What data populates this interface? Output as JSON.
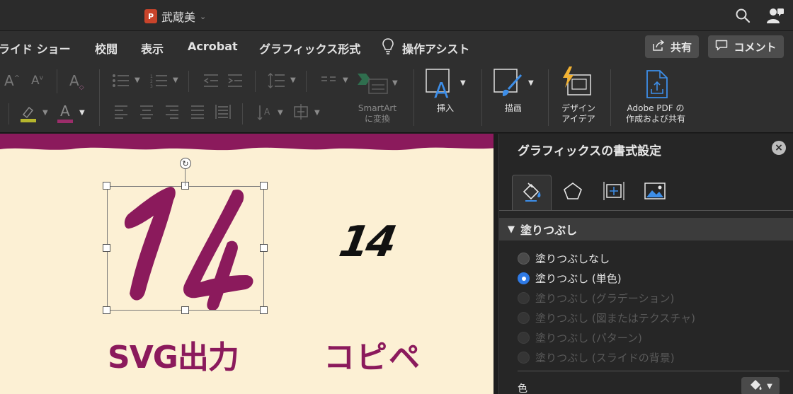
{
  "titlebar": {
    "document_name": "武蔵美",
    "app_icon_letter": "P"
  },
  "ribbon_tabs": [
    {
      "label": "ライド ショー"
    },
    {
      "label": "校閲"
    },
    {
      "label": "表示"
    },
    {
      "label": "Acrobat"
    },
    {
      "label": "グラフィックス形式"
    },
    {
      "label": "操作アシスト"
    }
  ],
  "actions": {
    "share_label": "共有",
    "comment_label": "コメント"
  },
  "ribbon": {
    "smartart_label_line1": "SmartArt",
    "smartart_label_line2": "に変換",
    "insert_label": "挿入",
    "draw_label": "描画",
    "design_label_line1": "デザイン",
    "design_label_line2": "アイデア",
    "adobe_label_line1": "Adobe PDF の",
    "adobe_label_line2": "作成および共有",
    "font_color_sample": "#9c2d6a",
    "highlight_color_sample": "#b5b52d"
  },
  "slide": {
    "number_svg": "14",
    "number_copy": "14",
    "label_svg": "SVG出力",
    "label_copy": "コピペ",
    "accent_color": "#8b1a5c",
    "background_color": "#fcf0d4"
  },
  "format_pane": {
    "title": "グラフィックスの書式設定",
    "section_title": "塗りつぶし",
    "fill_options": [
      {
        "label": "塗りつぶしなし",
        "state": "enabled"
      },
      {
        "label": "塗りつぶし (単色)",
        "state": "checked"
      },
      {
        "label": "塗りつぶし (グラデーション)",
        "state": "disabled"
      },
      {
        "label": "塗りつぶし (図またはテクスチャ)",
        "state": "disabled"
      },
      {
        "label": "塗りつぶし (パターン)",
        "state": "disabled"
      },
      {
        "label": "塗りつぶし (スライドの背景)",
        "state": "disabled"
      }
    ],
    "color_label": "色",
    "accent_blue": "#2f7ae5"
  }
}
